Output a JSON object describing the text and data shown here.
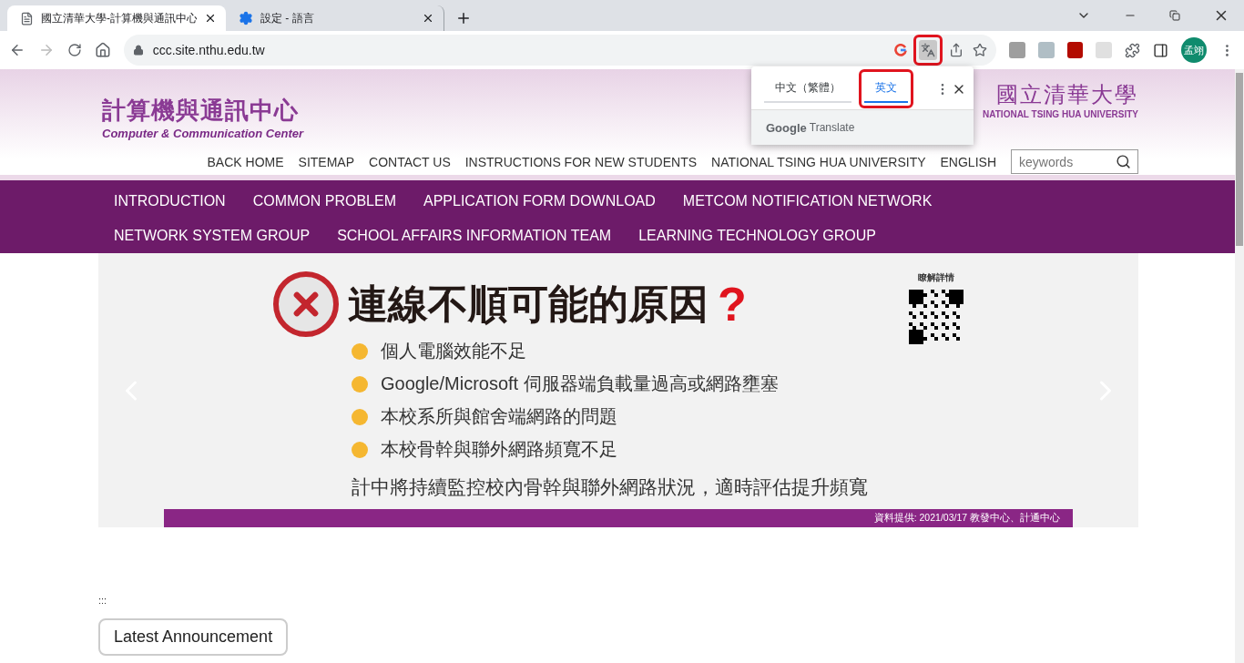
{
  "tabs": [
    {
      "title": "國立清華大學-計算機與通訊中心",
      "selected": true
    },
    {
      "title": "設定 - 語言",
      "selected": false
    }
  ],
  "address": {
    "url": "ccc.site.nthu.edu.tw"
  },
  "profile": {
    "initials": "孟翊"
  },
  "translate_popup": {
    "languages": [
      {
        "label": "中文（繁體）",
        "selected": false,
        "highlighted": false
      },
      {
        "label": "英文",
        "selected": true,
        "highlighted": true
      }
    ],
    "brand": "Google",
    "product": "Translate",
    "icon_highlighted": true
  },
  "site": {
    "logo_zh": "計算機與通訊中心",
    "logo_en": "Computer & Communication Center",
    "university_zh": "國立清華大學",
    "university_en": "NATIONAL TSING HUA UNIVERSITY",
    "top_links": [
      "BACK HOME",
      "SITEMAP",
      "CONTACT US",
      "INSTRUCTIONS FOR NEW STUDENTS",
      "NATIONAL TSING HUA UNIVERSITY",
      "ENGLISH"
    ],
    "search": {
      "placeholder": "keywords"
    },
    "menu": [
      [
        "INTRODUCTION",
        "COMMON PROBLEM",
        "APPLICATION FORM DOWNLOAD",
        "METCOM NOTIFICATION NETWORK"
      ],
      [
        "NETWORK SYSTEM GROUP",
        "SCHOOL AFFAIRS INFORMATION TEAM",
        "LEARNING TECHNOLOGY GROUP"
      ]
    ]
  },
  "banner": {
    "title": "連線不順可能的原因",
    "title_mark": "?",
    "qr_label": "瞭解詳情",
    "reasons": [
      "個人電腦效能不足",
      "Google/Microsoft 伺服器端負載量過高或網路壅塞",
      "本校系所與館舍端網路的問題",
      "本校骨幹與聯外網路頻寬不足"
    ],
    "note": "計中將持續監控校內骨幹與聯外網路狀況，適時評估提升頻寬",
    "credit": "資料提供: 2021/03/17 教發中心、計通中心"
  },
  "accesskey": ":::",
  "announcement_button": "Latest Announcement"
}
